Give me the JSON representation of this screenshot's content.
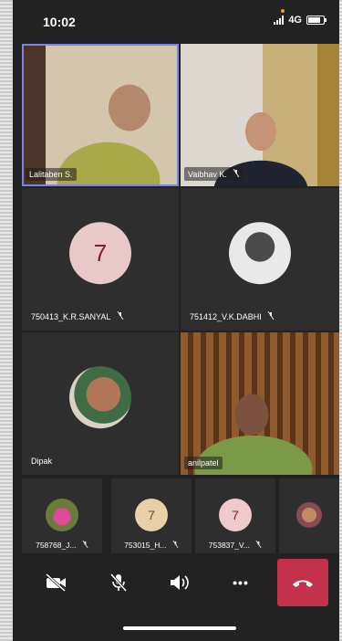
{
  "status_bar": {
    "time": "10:02",
    "network": "4G"
  },
  "participants": {
    "lalitaben": {
      "name": "Lalitaben S."
    },
    "vaibhav": {
      "name": "Vaibhav K."
    },
    "sanyal": {
      "name": "750413_K.R.SANYAL",
      "initial": "7"
    },
    "dabhi": {
      "name": "751412_V.K.DABHI"
    },
    "dipak": {
      "name": "Dipak"
    },
    "anilpatel": {
      "name": "anilpatel"
    }
  },
  "strip": [
    {
      "name": "758768_J...",
      "initial": ""
    },
    {
      "name": "753015_H...",
      "initial": "7"
    },
    {
      "name": "753837_V...",
      "initial": "7"
    }
  ],
  "controls": {
    "camera_icon": "video-off-icon",
    "mic_icon": "mic-off-icon",
    "speaker_icon": "speaker-icon",
    "more_label": "•••",
    "hangup_icon": "hang-up-icon"
  },
  "colors": {
    "hangup": "#c4314b",
    "avatar_bg": "#e8c8c8",
    "avatar_text": "#7a1f36",
    "selected_outline": "#7b83eb"
  }
}
